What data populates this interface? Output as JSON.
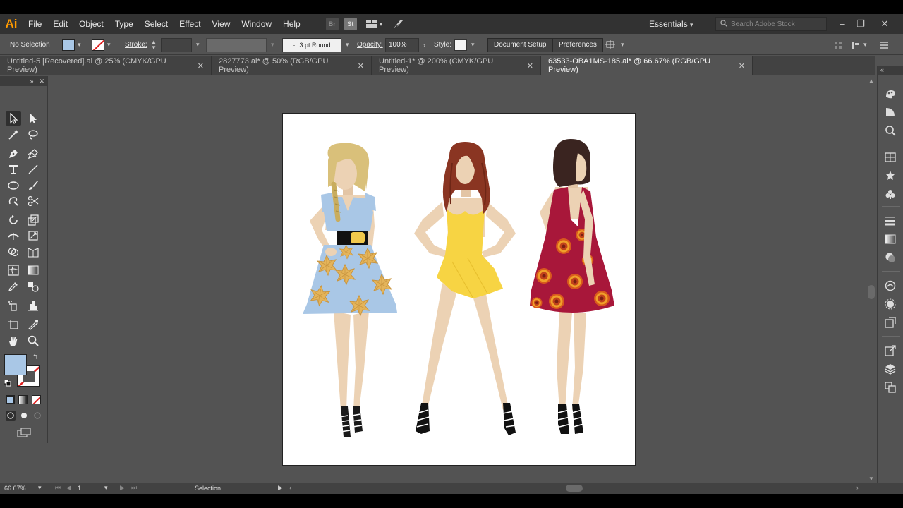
{
  "app": {
    "logo": "Ai",
    "menu": [
      "File",
      "Edit",
      "Object",
      "Type",
      "Select",
      "Effect",
      "View",
      "Window",
      "Help"
    ],
    "bridge_label": "Br",
    "stock_label": "St",
    "workspace": "Essentials",
    "search_placeholder": "Search Adobe Stock"
  },
  "control": {
    "selection": "No Selection",
    "fill_color": "#a9c7e6",
    "stroke_label": "Stroke:",
    "brush": "3 pt Round",
    "opacity_label": "Opacity:",
    "opacity_value": "100%",
    "style_label": "Style:",
    "document_setup": "Document Setup",
    "preferences": "Preferences"
  },
  "tabs": [
    {
      "label": "Untitled-5 [Recovered].ai @ 25% (CMYK/GPU Preview)",
      "active": false
    },
    {
      "label": "2827773.ai* @ 50% (RGB/GPU Preview)",
      "active": false
    },
    {
      "label": "Untitled-1* @ 200% (CMYK/GPU Preview)",
      "active": false
    },
    {
      "label": "63533-OBA1MS-185.ai* @ 66.67% (RGB/GPU Preview)",
      "active": true
    }
  ],
  "status": {
    "zoom": "66.67%",
    "artboard": "1",
    "tool": "Selection"
  },
  "colors": {
    "fill": "#a9c7e6",
    "blue_dress": "#a9c7e6",
    "yellow_dress": "#f7d443",
    "red_dress": "#a8173a",
    "skin": "#ecd2b4",
    "blonde_hair": "#d9c07a",
    "auburn_hair": "#8a3522",
    "dark_hair": "#3a2420",
    "leaf": "#e4b45a"
  }
}
